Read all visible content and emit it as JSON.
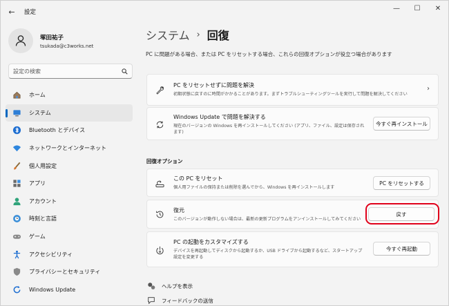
{
  "window": {
    "title": "設定",
    "back": "←",
    "minimize": "—",
    "maximize": "☐",
    "close": "✕"
  },
  "profile": {
    "name": "塚田祐子",
    "email": "tsukada@c3works.net"
  },
  "search": {
    "placeholder": "設定の検索"
  },
  "sidebar": {
    "items": [
      {
        "label": "ホーム",
        "icon": "home-icon"
      },
      {
        "label": "システム",
        "icon": "system-icon",
        "active": true
      },
      {
        "label": "Bluetooth とデバイス",
        "icon": "bluetooth-icon"
      },
      {
        "label": "ネットワークとインターネット",
        "icon": "wifi-icon"
      },
      {
        "label": "個人用設定",
        "icon": "brush-icon"
      },
      {
        "label": "アプリ",
        "icon": "apps-icon"
      },
      {
        "label": "アカウント",
        "icon": "account-icon"
      },
      {
        "label": "時刻と言語",
        "icon": "globe-clock-icon"
      },
      {
        "label": "ゲーム",
        "icon": "gamepad-icon"
      },
      {
        "label": "アクセシビリティ",
        "icon": "accessibility-icon"
      },
      {
        "label": "プライバシーとセキュリティ",
        "icon": "shield-icon"
      },
      {
        "label": "Windows Update",
        "icon": "update-icon"
      }
    ]
  },
  "main": {
    "breadcrumb_parent": "システム",
    "breadcrumb_sep": "›",
    "breadcrumb_current": "回復",
    "description": "PC に問題がある場合、または PC をリセットする場合、これらの回復オプションが役立つ場合があります",
    "cards": {
      "troubleshoot": {
        "title": "PC をリセットせずに問題を解決",
        "desc": "初期状態に戻すのに時間がかかることがあります。まずトラブルシューティングツールを実行して問題を解決してください",
        "chevron": "›"
      },
      "windows_update": {
        "title": "Windows Update で問題を解決する",
        "desc1": "現在のバージョンの Windows を再インストールしてください (アプリ、ファイル、設定は保存され",
        "desc2": "ます)",
        "button": "今すぐ再インストール"
      }
    },
    "section_label": "回復オプション",
    "options": {
      "reset": {
        "title": "この PC をリセット",
        "desc": "個人用ファイルの保持または削除を選んでから、Windows を再インストールします",
        "button": "PC をリセットする"
      },
      "go_back": {
        "title": "復元",
        "desc": "このバージョンが動作しない場合は、最新の更新プログラムをアンインストールしてみてください",
        "button": "戻す"
      },
      "advanced": {
        "title": "PC の起動をカスタマイズする",
        "desc1": "デバイスを再起動してディスクから起動するか、USB ドライブから起動するなど、スタートアップ",
        "desc2": "設定を変更する",
        "button": "今すぐ再起動"
      }
    },
    "links": {
      "help": "ヘルプを表示",
      "feedback": "フィードバックの送信"
    }
  },
  "colors": {
    "accent": "#0067c0",
    "highlight": "#e0001a"
  }
}
